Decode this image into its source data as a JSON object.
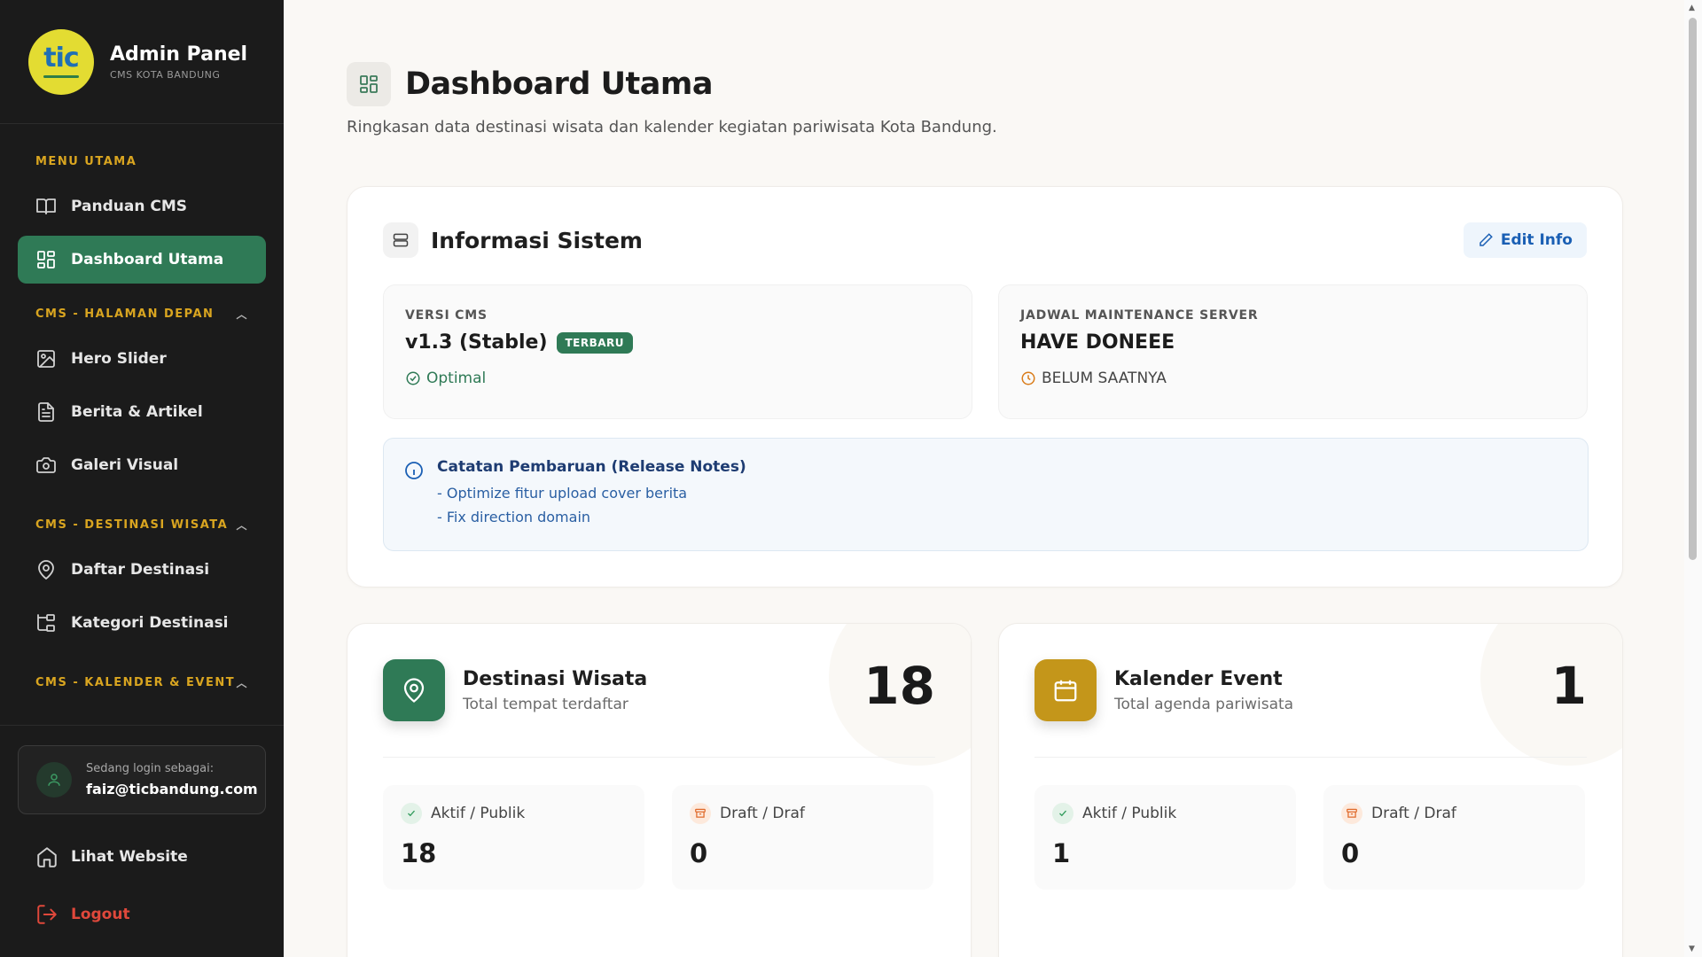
{
  "brand": {
    "logo_text": "tic",
    "title": "Admin Panel",
    "subtitle": "CMS KOTA BANDUNG"
  },
  "nav": {
    "sections": [
      {
        "label": "MENU UTAMA"
      },
      {
        "label": "CMS - HALAMAN DEPAN"
      },
      {
        "label": "CMS - DESTINASI WISATA"
      },
      {
        "label": "CMS - KALENDER & EVENT"
      }
    ],
    "items": {
      "panduan": "Panduan CMS",
      "dashboard": "Dashboard Utama",
      "hero": "Hero Slider",
      "berita": "Berita & Artikel",
      "galeri": "Galeri Visual",
      "destinasi": "Daftar Destinasi",
      "kategori": "Kategori Destinasi"
    }
  },
  "login": {
    "label": "Sedang login sebagai:",
    "email": "faiz@ticbandung.com"
  },
  "bottom": {
    "website": "Lihat Website",
    "logout": "Logout"
  },
  "page": {
    "title": "Dashboard Utama",
    "subtitle": "Ringkasan data destinasi wisata dan kalender kegiatan pariwisata Kota Bandung."
  },
  "info": {
    "title": "Informasi Sistem",
    "edit_label": "Edit Info",
    "version": {
      "label": "VERSI CMS",
      "value": "v1.3 (Stable)",
      "badge": "TERBARU",
      "status": "Optimal"
    },
    "maintenance": {
      "label": "JADWAL MAINTENANCE SERVER",
      "value": "HAVE DONEEE",
      "status": "BELUM SAATNYA"
    },
    "notes": {
      "title": "Catatan Pembaruan (Release Notes)",
      "lines": [
        "- Optimize fitur upload cover berita",
        "- Fix direction domain"
      ]
    }
  },
  "stats": {
    "destinasi": {
      "title": "Destinasi Wisata",
      "subtitle": "Total tempat terdaftar",
      "total": "18",
      "active_label": "Aktif / Publik",
      "active": "18",
      "draft_label": "Draft / Draf",
      "draft": "0"
    },
    "kalender": {
      "title": "Kalender Event",
      "subtitle": "Total agenda pariwisata",
      "total": "1",
      "active_label": "Aktif / Publik",
      "active": "1",
      "draft_label": "Draft / Draf",
      "draft": "0"
    }
  },
  "colors": {
    "accent_green": "#2f7a56",
    "section_gold": "#d9a520",
    "event_gold": "#c4961a",
    "logout_red": "#e0483b",
    "link_blue": "#1a5fb4"
  }
}
